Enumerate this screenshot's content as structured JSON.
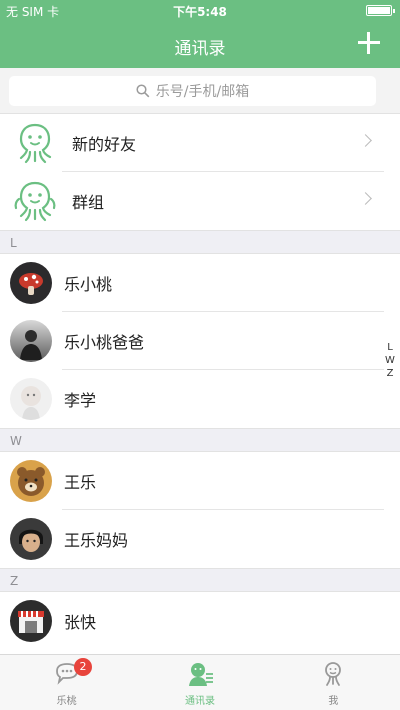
{
  "status_bar": {
    "carrier": "无 SIM 卡 ︎",
    "time": "下午5:48"
  },
  "header": {
    "title": "通讯录"
  },
  "search": {
    "placeholder": "乐号/手机/邮箱"
  },
  "special_items": [
    {
      "label": "新的好友"
    },
    {
      "label": "群组"
    }
  ],
  "sections": [
    {
      "letter": "L",
      "contacts": [
        {
          "name": "乐小桃"
        },
        {
          "name": "乐小桃爸爸"
        },
        {
          "name": "李学"
        }
      ]
    },
    {
      "letter": "W",
      "contacts": [
        {
          "name": "王乐"
        },
        {
          "name": "王乐妈妈"
        }
      ]
    },
    {
      "letter": "Z",
      "contacts": [
        {
          "name": "张快"
        }
      ]
    }
  ],
  "index_bar": [
    "L",
    "W",
    "Z"
  ],
  "tabbar": {
    "tabs": [
      {
        "label": "乐桃",
        "badge": "2"
      },
      {
        "label": "通讯录"
      },
      {
        "label": "我"
      }
    ]
  },
  "colors": {
    "accent": "#6bbf82",
    "badge": "#e8443c"
  }
}
